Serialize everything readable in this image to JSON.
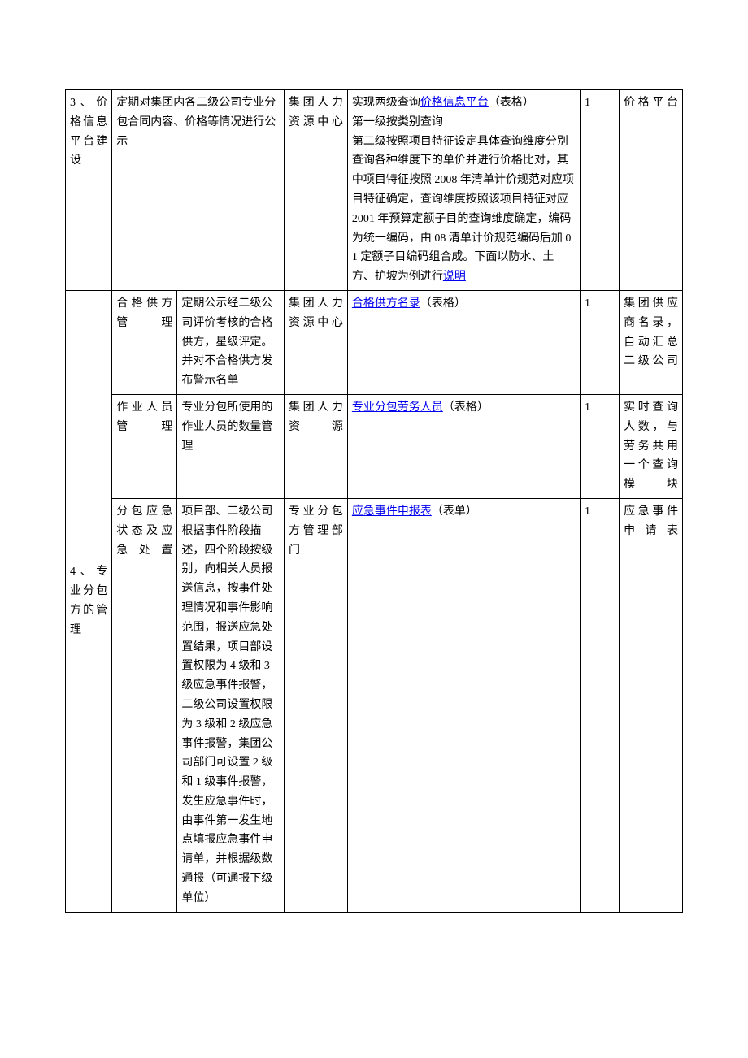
{
  "rows": [
    {
      "module": "3、价格信息平台建设",
      "moduleRowspan": 1,
      "sub": "",
      "subColspan": 2,
      "desc": "定期对集团内各二级公司专业分包合同内容、价格等情况进行公示",
      "dept": "集团人力资源中心",
      "detailPrefix": "实现两级查询",
      "detailLinkText": "价格信息平台",
      "detailAfterLink": "（表格）",
      "detailLines": [
        "第一级按类别查询",
        "第二级按照项目特征设定具体查询维度分别查询各种维度下的单价并进行价格比对，其中项目特征按照 2008 年清单计价规范对应项目特征确定，查询维度按照该项目特征对应 2001 年预算定额子目的查询维度确定，编码为统一编码，由 08 清单计价规范编码后加 01 定额子目编码组合成。下面以防水、土方、护坡为例进行"
      ],
      "detailTrailingLink": "说明",
      "num": "1",
      "remark": "价格平台"
    },
    {
      "module": "4、专业分包方的管理",
      "moduleRowspan": 3,
      "sub": "合格供方管理",
      "desc": "定期公示经二级公司评价考核的合格供方，星级评定。并对不合格供方发布警示名单",
      "dept": "集团人力资源中心",
      "detailLinkText": "合格供方名录",
      "detailAfterLink": "（表格）",
      "num": "1",
      "remark": "集团供应商名录，自动汇总二级公司"
    },
    {
      "sub": "作业人员管理",
      "desc": "专业分包所使用的作业人员的数量管理",
      "dept": "集团人力资源",
      "detailLinkText": "专业分包劳务人员",
      "detailAfterLink": "（表格）",
      "num": "1",
      "remark": "实时查询人数，与劳务共用一个查询模块"
    },
    {
      "sub": "分包应急状态及应急处置",
      "desc": "项目部、二级公司根据事件阶段描述，四个阶段按级别，向相关人员报送信息，按事件处理情况和事件影响范围，报送应急处置结果，项目部设置权限为 4 级和 3 级应急事件报警，二级公司设置权限为 3 级和 2 级应急事件报警，集团公司部门可设置 2 级和 1 级事件报警，发生应急事件时，由事件第一发生地点填报应急事件申请单，并根据级数通报（可通报下级单位）",
      "dept": "专业分包方管理部门",
      "detailLinkText": "应急事件申报表",
      "detailAfterLink": "（表单）",
      "num": "1",
      "remark": "应急事件申请表"
    }
  ]
}
